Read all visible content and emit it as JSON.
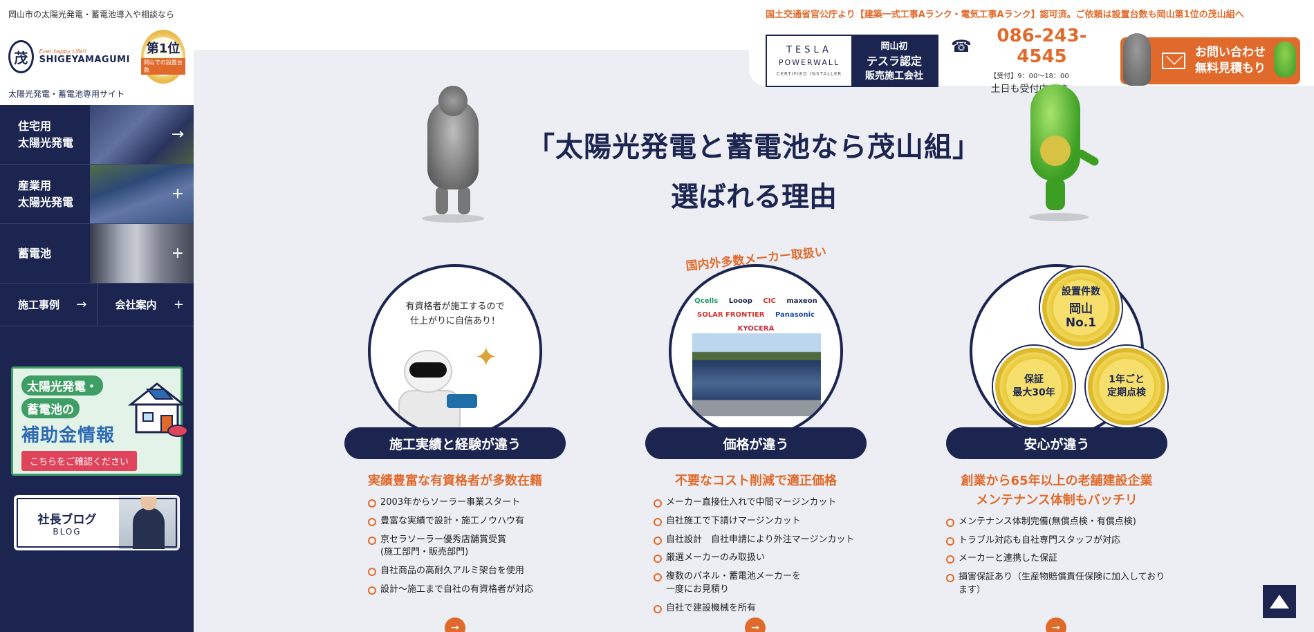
{
  "sidebar": {
    "tagline": "岡山市の太陽光発電・蓄電池導入や相談なら",
    "logo_script": "Ever happy Life!!",
    "logo_name": "SHIGEYAMAGUMI",
    "badge_rank": "第1位",
    "badge_sub": "岡山での設置台数",
    "site_name": "太陽光発電・蓄電池専用サイト",
    "nav": [
      {
        "label_l1": "住宅用",
        "label_l2": "太陽光発電",
        "symbol": "→"
      },
      {
        "label_l1": "産業用",
        "label_l2": "太陽光発電",
        "symbol": "+"
      },
      {
        "label_l1": "蓄電池",
        "label_l2": "",
        "symbol": "+"
      }
    ],
    "split": [
      {
        "label": "施工事例",
        "symbol": "→"
      },
      {
        "label": "会社案内",
        "symbol": "+"
      }
    ],
    "subsidy": {
      "line1": "太陽光発電・",
      "line2": "蓄電池の",
      "line3": "補助金情報",
      "button": "こちらをご確認ください"
    },
    "blog": {
      "title": "社長ブログ",
      "sub": "BLOG"
    }
  },
  "header": {
    "notice": "国土交通省官公庁より【建築一式工事Aランク・電気工事Aランク】認可済。ご依頼は設置台数も岡山第1位の茂山組へ",
    "tesla": {
      "word": "TESLA",
      "powerwall": "POWERWALL",
      "certified": "CERTIFIED INSTALLER",
      "r1": "岡山初",
      "r2": "テスラ認定",
      "r3": "販売施工会社"
    },
    "phone": "086-243-4545",
    "hours": "【受付】9：00〜18：00",
    "open": "土日も受付中です",
    "contact_l1": "お問い合わせ",
    "contact_l2": "無料見積もり"
  },
  "heading": {
    "line1": "「太陽光発電と蓄電池なら茂山組」",
    "line2": "選ばれる理由"
  },
  "columns": [
    {
      "caption_l1": "有資格者が施工するので",
      "caption_l2": "仕上がりに自信あり！",
      "pill": "施工実績と経験が違う",
      "head_l1": "実績豊富な有資格者が多数在籍",
      "head_l2": "",
      "items": [
        "2003年からソーラー事業スタート",
        "豊富な実績で設計・施工ノウハウ有",
        "京セラソーラー優秀店舗賞受賞\n(施工部門・販売部門)",
        "自社商品の高耐久アルミ架台を使用",
        "設計〜施工まで自社の有資格者が対応"
      ]
    },
    {
      "arc": "国内外多数メーカー取扱い",
      "makers_r1": [
        "Qcells",
        "Looop",
        "CIC",
        "maxeon"
      ],
      "makers_r2": [
        "SOLAR FRONTIER",
        "Panasonic",
        "KYOCERA"
      ],
      "pill": "価格が違う",
      "head_l1": "不要なコスト削減で適正価格",
      "head_l2": "",
      "items": [
        "メーカー直接仕入れで中間マージンカット",
        "自社施工で下請けマージンカット",
        "自社設計　自社申請により外注マージンカット",
        "厳選メーカーのみ取扱い",
        "複数のパネル・蓄電池メーカーを\n一度にお見積り",
        "自社で建設機械を所有"
      ]
    },
    {
      "medals": [
        {
          "l1": "設置件数",
          "l2": "岡山",
          "l3": "No.1"
        },
        {
          "l1": "保証",
          "l2": "最大30年",
          "l3": ""
        },
        {
          "l1": "1年ごと",
          "l2": "定期点検",
          "l3": ""
        }
      ],
      "pill": "安心が違う",
      "head_l1": "創業から65年以上の老舗建設企業",
      "head_l2": "メンテナンス体制もバッチリ",
      "items": [
        "メンテナンス体制完備(無償点検・有償点検)",
        "トラブル対応も自社専門スタッフが対応",
        "メーカーと連携した保証",
        "損害保証あり（生産物賠償責任保険に加入しております）"
      ]
    }
  ],
  "more_symbol": "→",
  "colors": {
    "navy": "#1b2550",
    "orange": "#e06a2b",
    "green": "#3f9e65"
  }
}
